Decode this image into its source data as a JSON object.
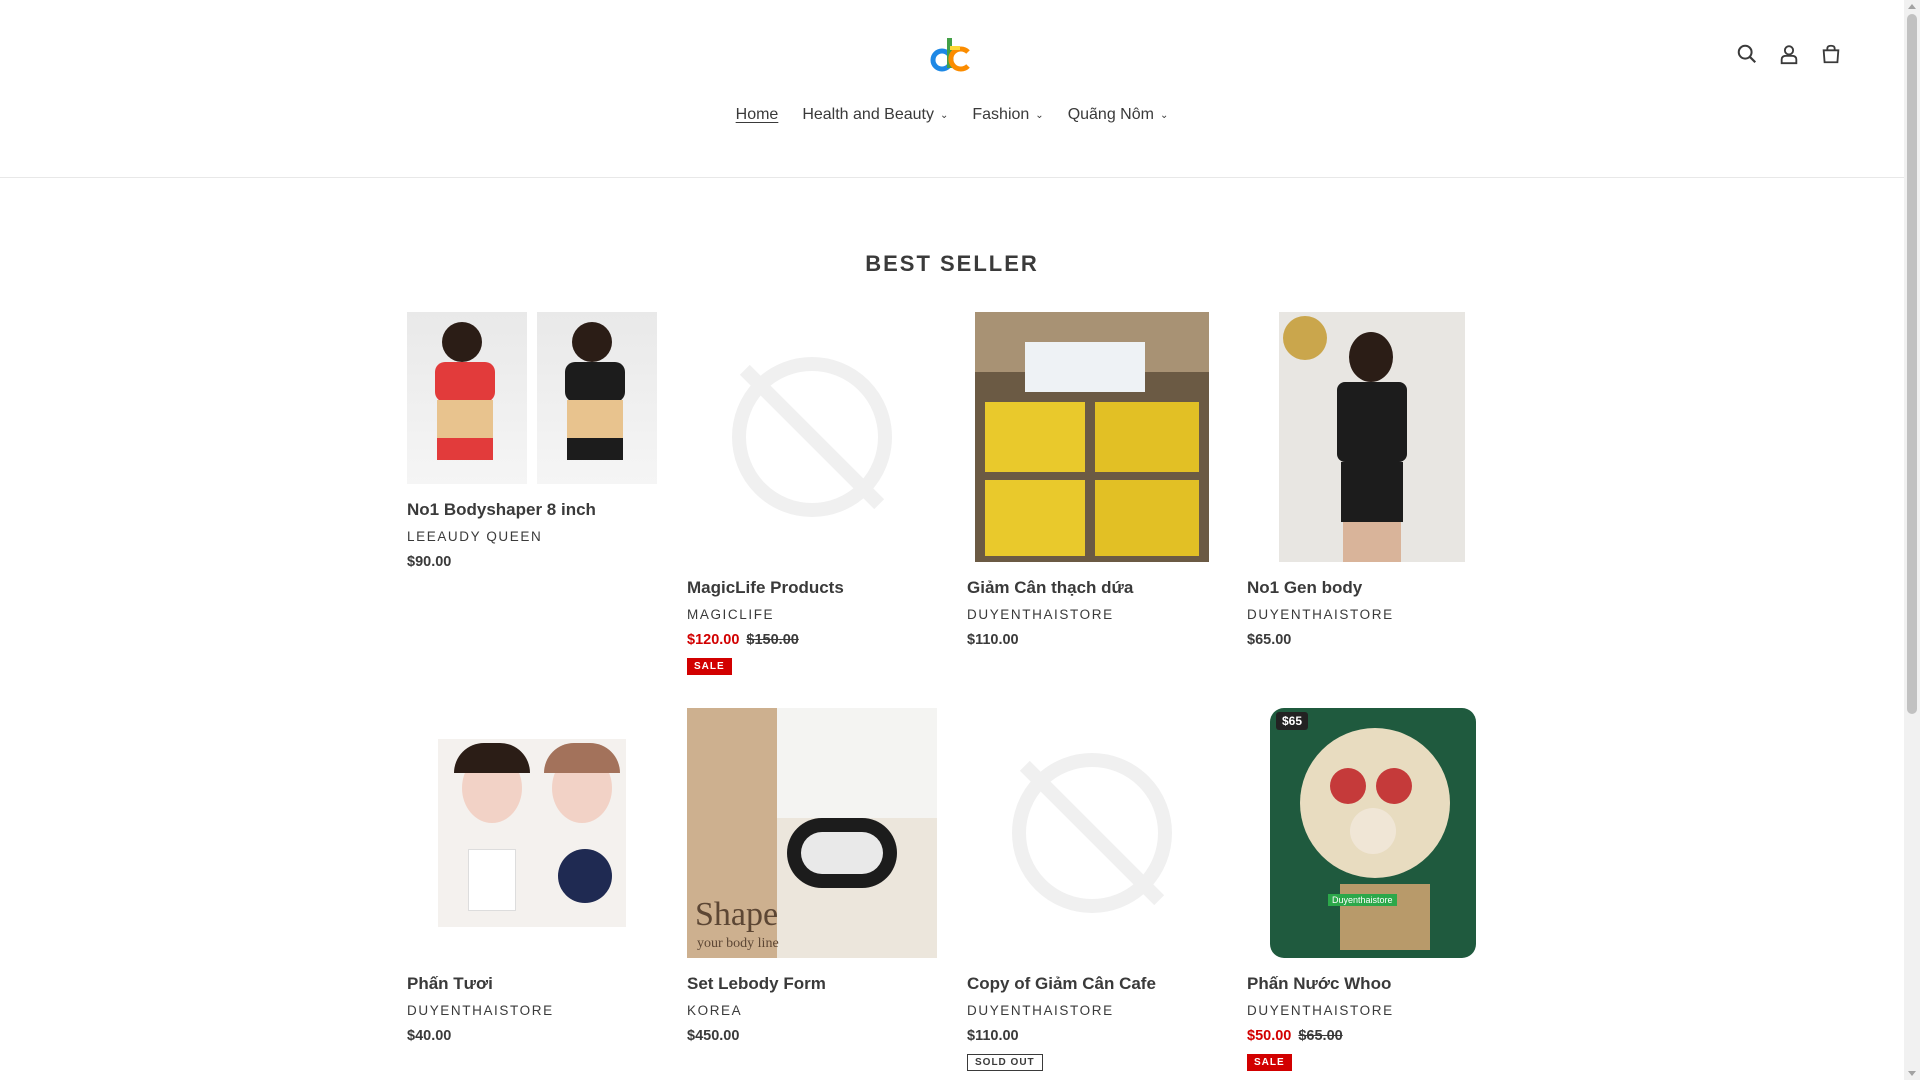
{
  "header": {
    "logo_icon": "store-logo",
    "icons": [
      "search-icon",
      "account-icon",
      "cart-icon"
    ]
  },
  "nav": {
    "items": [
      {
        "label": "Home",
        "active": true,
        "dropdown": false
      },
      {
        "label": "Health and Beauty",
        "active": false,
        "dropdown": true
      },
      {
        "label": "Fashion",
        "active": false,
        "dropdown": true
      },
      {
        "label": "Quãng Nôm",
        "active": false,
        "dropdown": true
      }
    ]
  },
  "section": {
    "title": "BEST SELLER"
  },
  "products": [
    {
      "title": "No1 Bodyshaper 8 inch",
      "vendor": "LEEAUDY QUEEN",
      "price": "$90.00",
      "compare": "",
      "badge": ""
    },
    {
      "title": "MagicLife Products",
      "vendor": "MAGICLIFE",
      "price": "$120.00",
      "compare": "$150.00",
      "badge": "SALE"
    },
    {
      "title": "Giảm Cân thạch dứa",
      "vendor": "DUYENTHAISTORE",
      "price": "$110.00",
      "compare": "",
      "badge": ""
    },
    {
      "title": "No1 Gen body",
      "vendor": "DUYENTHAISTORE",
      "price": "$65.00",
      "compare": "",
      "badge": ""
    },
    {
      "title": "Phấn Tươi",
      "vendor": "DUYENTHAISTORE",
      "price": "$40.00",
      "compare": "",
      "badge": ""
    },
    {
      "title": "Set Lebody Form",
      "vendor": "KOREA",
      "price": "$450.00",
      "compare": "",
      "badge": ""
    },
    {
      "title": "Copy of Giảm Cân Cafe",
      "vendor": "DUYENTHAISTORE",
      "price": "$110.00",
      "compare": "",
      "badge": "SOLD OUT"
    },
    {
      "title": "Phấn Nước Whoo",
      "vendor": "DUYENTHAISTORE",
      "price": "$50.00",
      "compare": "$65.00",
      "badge": "SALE"
    }
  ],
  "image_text": {
    "lebody_shape": "Shape",
    "lebody_sub": "your body line",
    "whoo_tag": "$65",
    "whoo_store": "Duyenthaistore"
  },
  "colors": {
    "sale": "#d20000",
    "text": "#3a3a3a"
  }
}
